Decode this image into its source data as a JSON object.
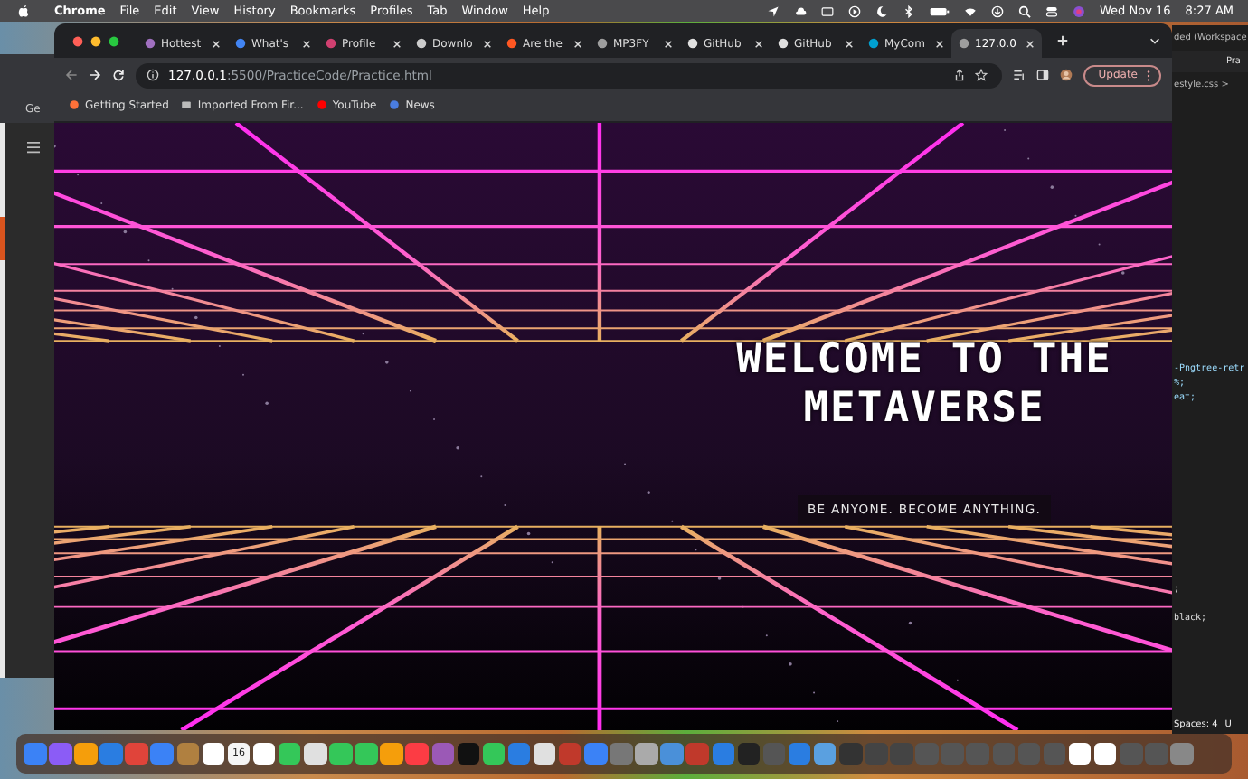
{
  "menu_bar": {
    "app": "Chrome",
    "items": [
      "File",
      "Edit",
      "View",
      "History",
      "Bookmarks",
      "Profiles",
      "Tab",
      "Window",
      "Help"
    ],
    "date": "Wed Nov 16",
    "time": "8:27 AM"
  },
  "back_window": {
    "bookmark": "Ge"
  },
  "browser": {
    "tabs": [
      {
        "label": "Hottest",
        "selected": false
      },
      {
        "label": "What's",
        "selected": false
      },
      {
        "label": "Profile",
        "selected": false
      },
      {
        "label": "Downlo",
        "selected": false
      },
      {
        "label": "Are the",
        "selected": false
      },
      {
        "label": "MP3FY",
        "selected": false
      },
      {
        "label": "GitHub",
        "selected": false
      },
      {
        "label": "GitHub",
        "selected": false
      },
      {
        "label": "MyCom",
        "selected": false
      },
      {
        "label": "127.0.0",
        "selected": true
      }
    ],
    "url_host": "127.0.0.1",
    "url_path": ":5500/PracticeCode/Practice.html",
    "update_button": "Update",
    "bookmarks": [
      "Getting Started",
      "Imported From Fir...",
      "YouTube",
      "News"
    ]
  },
  "page": {
    "heading": "WELCOME TO THE METAVERSE",
    "tagline": "BE ANYONE. BECOME ANYTHING."
  },
  "editor": {
    "title": "ded (Workspace",
    "tab": "Pra",
    "breadcrumb": "estyle.css >",
    "code_lines": [
      "-Pngtree-retr",
      "%;",
      "eat;",
      ";",
      "black;"
    ],
    "status": "Spaces: 4",
    "status_2": "U"
  },
  "dock": {
    "calendar_day": "16"
  }
}
